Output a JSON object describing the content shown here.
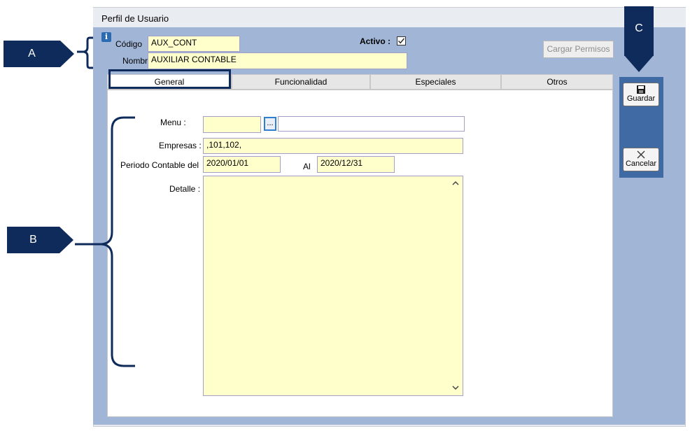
{
  "window": {
    "title": "Perfil de Usuario"
  },
  "header": {
    "codigo_label": "Código",
    "codigo_value": "AUX_CONT",
    "nombre_label": "Nombre",
    "nombre_value": "AUXILIAR CONTABLE",
    "activo_label": "Activo :",
    "activo_checked": true,
    "cargar_permisos_label": "Cargar Permisos"
  },
  "tabs": [
    {
      "label": "General"
    },
    {
      "label": "Funcionalidad"
    },
    {
      "label": "Especiales"
    },
    {
      "label": "Otros"
    }
  ],
  "general": {
    "menu_label": "Menu :",
    "menu_button": "...",
    "empresas_label": "Empresas :",
    "empresas_value": ",101,102,",
    "periodo_label": "Periodo Contable del",
    "periodo_desde": "2020/01/01",
    "al_label": "Al",
    "periodo_hasta": "2020/12/31",
    "detalle_label": "Detalle :"
  },
  "actions": {
    "guardar_label": "Guardar",
    "cancelar_label": "Cancelar"
  },
  "callouts": {
    "a": "A",
    "b": "B",
    "c": "C"
  },
  "colors": {
    "callout": "#0f2b5b",
    "field_bg": "#ffffcc",
    "panel": "#a1b6d6",
    "button_panel": "#3f6aa3"
  }
}
